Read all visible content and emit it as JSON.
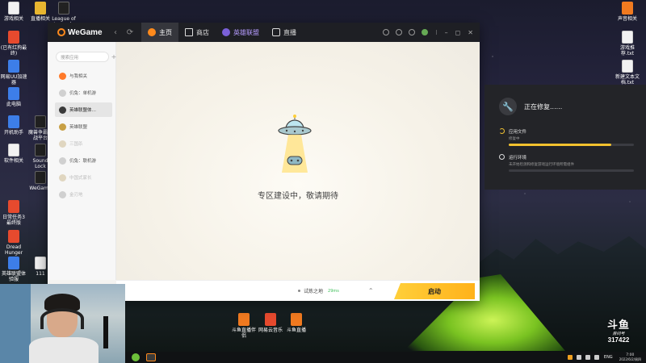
{
  "desktop_icons_left": [
    {
      "label": "游戏相关",
      "glyph": "g-doc"
    },
    {
      "label": "直播相关",
      "glyph": "g-yellow"
    },
    {
      "label": "League of Legends",
      "glyph": "g-dark"
    },
    {
      "label": "(已有红狗最终)",
      "glyph": "g-red"
    },
    {
      "label": "网易UU加速器",
      "glyph": "g-blue"
    },
    {
      "label": "此电脑",
      "glyph": "g-blue"
    },
    {
      "label": "开机助手",
      "glyph": "g-blue"
    },
    {
      "label": "魔兽争霸对战平台",
      "glyph": "g-dark"
    },
    {
      "label": "软件相关",
      "glyph": "g-doc"
    },
    {
      "label": "Sound Lock",
      "glyph": "g-dark"
    },
    {
      "label": "WeGame",
      "glyph": "g-dark"
    },
    {
      "label": "日常任务3 最终版",
      "glyph": "g-red"
    },
    {
      "label": "Dread Hunger",
      "glyph": "g-red"
    },
    {
      "label": "英雄联盟体验服",
      "glyph": "g-blue"
    },
    {
      "label": "111",
      "glyph": "g-doc"
    }
  ],
  "desktop_icons_right": [
    {
      "label": "声音相关",
      "glyph": "g-orange"
    },
    {
      "label": "游戏推荐.txt",
      "glyph": "g-doc"
    },
    {
      "label": "新建文本文档.txt",
      "glyph": "g-doc"
    }
  ],
  "desktop_icons_bottom": [
    {
      "label": "斗鱼直播伴侣",
      "glyph": "g-orange"
    },
    {
      "label": "网易云音乐",
      "glyph": "g-red"
    },
    {
      "label": "斗鱼直播",
      "glyph": "g-orange"
    }
  ],
  "wegame": {
    "logo": "WeGame",
    "back": "‹",
    "refresh": "⟳",
    "tabs": [
      {
        "label": "主页",
        "icon": "home-icon"
      },
      {
        "label": "商店",
        "icon": "shop-icon"
      },
      {
        "label": "英雄联盟",
        "icon": "lol-icon"
      },
      {
        "label": "直播",
        "icon": "live-icon"
      }
    ],
    "window_buttons": [
      "⁝",
      "–",
      "◻",
      "✕"
    ],
    "search_placeholder": "搜索应用",
    "add": "+",
    "sidebar": [
      {
        "label": "与我相关",
        "icon": "orange",
        "state": ""
      },
      {
        "label": "仉兔：单机游",
        "icon": "grey",
        "state": ""
      },
      {
        "label": "英雄联盟体…",
        "icon": "dark",
        "state": "selected"
      },
      {
        "label": "英雄联盟",
        "icon": "gold",
        "state": ""
      },
      {
        "label": "三国杀",
        "icon": "pale",
        "state": "dim"
      },
      {
        "label": "仉兔：联机游",
        "icon": "grey",
        "state": ""
      },
      {
        "label": "中国式家长",
        "icon": "pale",
        "state": "dim"
      },
      {
        "label": "金刃地",
        "icon": "grey",
        "state": "dim"
      }
    ],
    "message": "专区建设中，敬请期待",
    "server": "试炼之地",
    "ping": "29ms",
    "chevron": "⌃",
    "start": "启动"
  },
  "repair": {
    "title": "正在修复......",
    "wrench": "🔧",
    "items": [
      {
        "title": "应用文件",
        "subtitle": "修复中",
        "progress": 0.82
      },
      {
        "title": "运行环境",
        "subtitle": "未开始检测和修复游戏运行环境所需组件",
        "progress": 0
      }
    ]
  },
  "watermark": {
    "logo": "斗鱼",
    "room_label": "房间号",
    "room_number": "317422"
  },
  "taskbar": {
    "lang": "ENG",
    "time": "7:00",
    "date": "2022/6/2/周四"
  },
  "colors": {
    "accent": "#ff8a1c",
    "start_button": "#ffbe24",
    "progress": "#f2c12e",
    "tab_lol": "#b69cff"
  }
}
